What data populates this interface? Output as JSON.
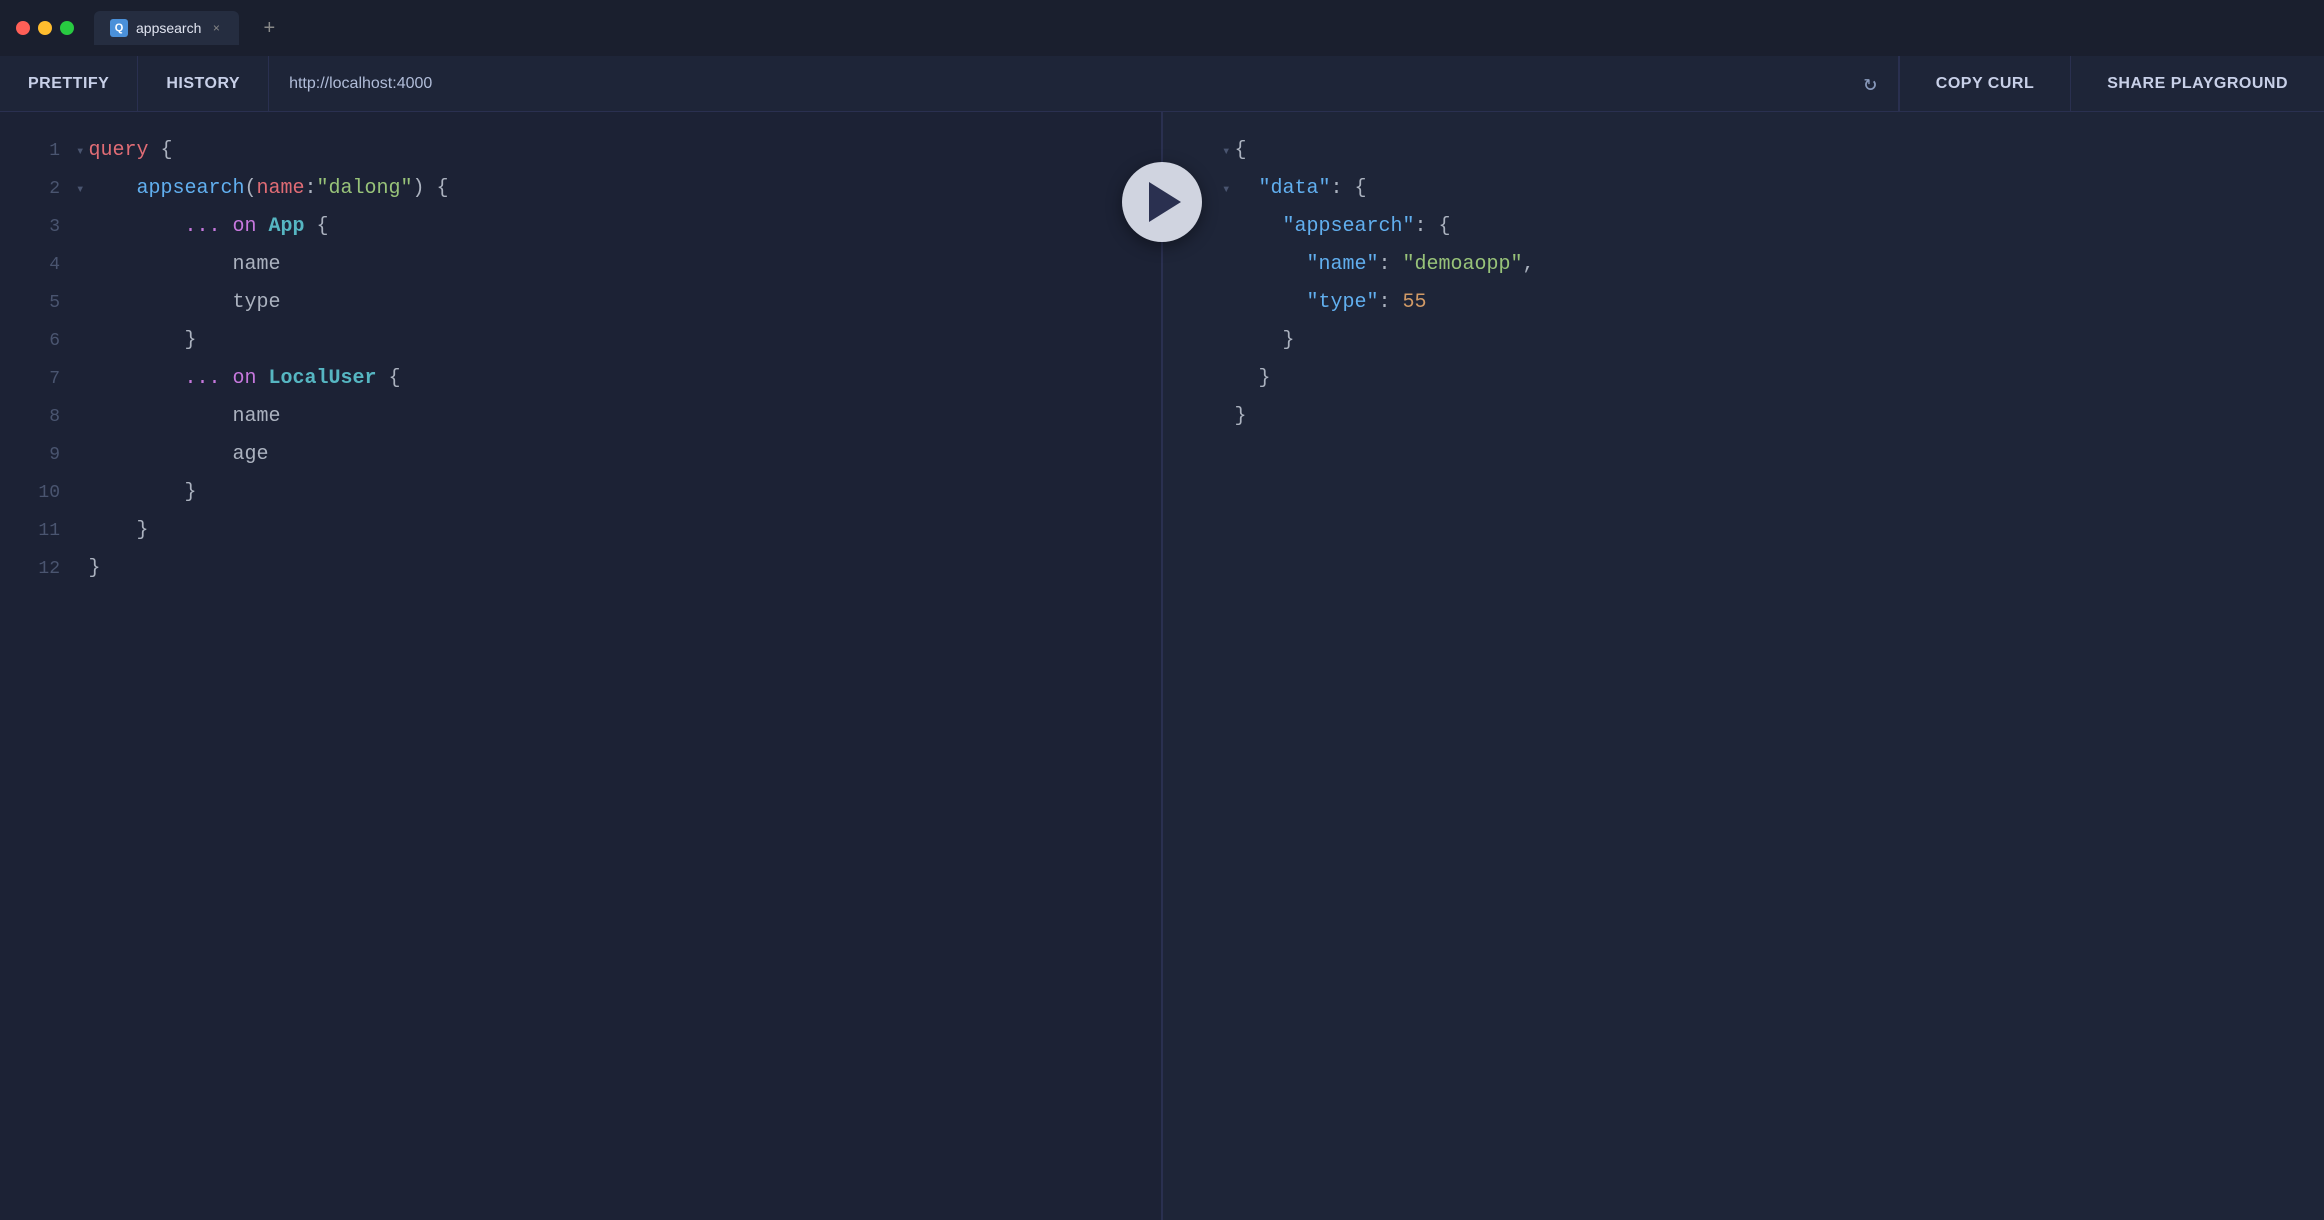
{
  "titlebar": {
    "tab_icon": "Q",
    "tab_label": "appsearch",
    "tab_close": "×",
    "tab_add": "+"
  },
  "toolbar": {
    "prettify_label": "PRETTIFY",
    "history_label": "HISTORY",
    "url_value": "http://localhost:4000",
    "copy_curl_label": "COPY CURL",
    "share_playground_label": "SHARE PLAYGROUND"
  },
  "editor": {
    "lines": [
      {
        "num": "1",
        "collapse": "▾",
        "content": "query {",
        "parts": [
          {
            "text": "query",
            "cls": "kw-query"
          },
          {
            "text": " {",
            "cls": "brace"
          }
        ]
      },
      {
        "num": "2",
        "collapse": "▾",
        "content": "  appsearch(name:\"dalong\") {",
        "parts": [
          {
            "text": "    appsearch",
            "cls": "fn-name"
          },
          {
            "text": "(",
            "cls": "brace"
          },
          {
            "text": "name",
            "cls": "param-key"
          },
          {
            "text": ":",
            "cls": "default-text"
          },
          {
            "text": "\"dalong\"",
            "cls": "param-val"
          },
          {
            "text": ") {",
            "cls": "brace"
          }
        ]
      },
      {
        "num": "3",
        "content": "      ... on App {",
        "parts": [
          {
            "text": "        ... ",
            "cls": "kw-spread"
          },
          {
            "text": "on ",
            "cls": "kw-on"
          },
          {
            "text": "App",
            "cls": "type-name"
          },
          {
            "text": " {",
            "cls": "brace"
          }
        ]
      },
      {
        "num": "4",
        "content": "        name",
        "parts": [
          {
            "text": "            name",
            "cls": "field-name"
          }
        ]
      },
      {
        "num": "5",
        "content": "        type",
        "parts": [
          {
            "text": "            type",
            "cls": "field-name"
          }
        ]
      },
      {
        "num": "6",
        "content": "      }",
        "parts": [
          {
            "text": "        }",
            "cls": "brace"
          }
        ]
      },
      {
        "num": "7",
        "content": "      ... on LocalUser {",
        "parts": [
          {
            "text": "        ... ",
            "cls": "kw-spread"
          },
          {
            "text": "on ",
            "cls": "kw-on"
          },
          {
            "text": "LocalUser",
            "cls": "type-name"
          },
          {
            "text": " {",
            "cls": "brace"
          }
        ]
      },
      {
        "num": "8",
        "content": "        name",
        "parts": [
          {
            "text": "            name",
            "cls": "field-name"
          }
        ]
      },
      {
        "num": "9",
        "content": "        age",
        "parts": [
          {
            "text": "            age",
            "cls": "field-name"
          }
        ]
      },
      {
        "num": "10",
        "content": "      }",
        "parts": [
          {
            "text": "        }",
            "cls": "brace"
          }
        ]
      },
      {
        "num": "11",
        "content": "  }",
        "parts": [
          {
            "text": "    }",
            "cls": "brace"
          }
        ]
      },
      {
        "num": "12",
        "content": "}",
        "parts": [
          {
            "text": "}",
            "cls": "brace"
          }
        ]
      }
    ]
  },
  "response": {
    "lines": [
      {
        "type": "collapse",
        "text": "{",
        "cls": "json-brace"
      },
      {
        "type": "collapse",
        "indent": 2,
        "key": "\"data\"",
        "text": ": {"
      },
      {
        "type": "normal",
        "indent": 4,
        "key": "\"appsearch\"",
        "text": ": {"
      },
      {
        "type": "normal",
        "indent": 6,
        "key": "\"name\"",
        "text": ": ",
        "val": "\"demoaopp\"",
        "valcls": "json-str-val",
        "comma": ","
      },
      {
        "type": "normal",
        "indent": 6,
        "key": "\"type\"",
        "text": ": ",
        "val": "55",
        "valcls": "json-num-val"
      },
      {
        "type": "normal",
        "indent": 4,
        "text": "}"
      },
      {
        "type": "normal",
        "indent": 2,
        "text": "}"
      },
      {
        "type": "normal",
        "indent": 0,
        "text": "}"
      }
    ]
  },
  "icons": {
    "refresh": "↻",
    "play": "▶"
  }
}
